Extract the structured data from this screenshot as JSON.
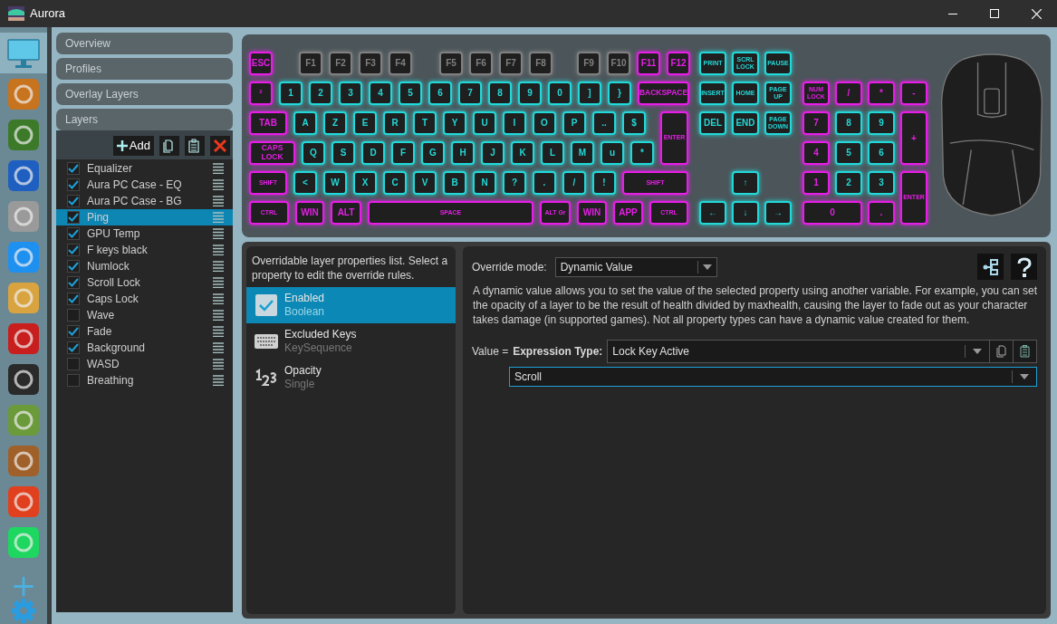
{
  "window": {
    "title": "Aurora"
  },
  "sidebar": {
    "apps": [
      {
        "kind": "monitor",
        "selected": true,
        "color": "#5fc8e8"
      },
      {
        "kind": "logo",
        "selected": false,
        "color": "#c8731e"
      },
      {
        "kind": "logo",
        "selected": false,
        "color": "#3c7a2a"
      },
      {
        "kind": "logo",
        "selected": false,
        "color": "#1e5fbf"
      },
      {
        "kind": "logo",
        "selected": false,
        "color": "#9a9a9a"
      },
      {
        "kind": "logo",
        "selected": false,
        "color": "#1e90f0"
      },
      {
        "kind": "logo",
        "selected": false,
        "color": "#d9a440"
      },
      {
        "kind": "logo",
        "selected": false,
        "color": "#c81e1e"
      },
      {
        "kind": "logo",
        "selected": false,
        "color": "#2a2a2a"
      },
      {
        "kind": "logo",
        "selected": false,
        "color": "#6a9a3a"
      },
      {
        "kind": "logo",
        "selected": false,
        "color": "#a0602a"
      },
      {
        "kind": "logo",
        "selected": false,
        "color": "#e0401e"
      },
      {
        "kind": "logo",
        "selected": false,
        "color": "#1ed760"
      }
    ]
  },
  "sections": [
    {
      "label": "Overview",
      "expanded": false
    },
    {
      "label": "Profiles",
      "expanded": false
    },
    {
      "label": "Overlay Layers",
      "expanded": false
    },
    {
      "label": "Layers",
      "expanded": true
    }
  ],
  "layer_toolbar": {
    "add_label": "Add"
  },
  "layers": [
    {
      "name": "Equalizer",
      "checked": true,
      "selected": false
    },
    {
      "name": "Aura PC Case - EQ",
      "checked": true,
      "selected": false
    },
    {
      "name": "Aura PC Case - BG",
      "checked": true,
      "selected": false
    },
    {
      "name": "Ping",
      "checked": true,
      "selected": true
    },
    {
      "name": "GPU Temp",
      "checked": true,
      "selected": false
    },
    {
      "name": "F keys black",
      "checked": true,
      "selected": false
    },
    {
      "name": "Numlock",
      "checked": true,
      "selected": false
    },
    {
      "name": "Scroll Lock",
      "checked": true,
      "selected": false
    },
    {
      "name": "Caps Lock",
      "checked": true,
      "selected": false
    },
    {
      "name": "Wave",
      "checked": false,
      "selected": false
    },
    {
      "name": "Fade",
      "checked": true,
      "selected": false
    },
    {
      "name": "Background",
      "checked": true,
      "selected": false
    },
    {
      "name": "WASD",
      "checked": false,
      "selected": false
    },
    {
      "name": "Breathing",
      "checked": false,
      "selected": false
    }
  ],
  "keyboard": {
    "main_rows": [
      [
        {
          "label": "ESC",
          "color": "#e61ee6"
        },
        {
          "label": "F1",
          "color": "#808080"
        },
        {
          "label": "F2",
          "color": "#808080"
        },
        {
          "label": "F3",
          "color": "#808080"
        },
        {
          "label": "F4",
          "color": "#808080"
        },
        {
          "label": "F5",
          "color": "#808080"
        },
        {
          "label": "F6",
          "color": "#808080"
        },
        {
          "label": "F7",
          "color": "#808080"
        },
        {
          "label": "F8",
          "color": "#808080"
        },
        {
          "label": "F9",
          "color": "#808080"
        },
        {
          "label": "F10",
          "color": "#808080"
        },
        {
          "label": "F11",
          "color": "#e61ee6"
        },
        {
          "label": "F12",
          "color": "#e61ee6"
        }
      ],
      [
        {
          "label": "²",
          "color": "#e61ee6"
        },
        {
          "label": "1",
          "color": "#22d8d8"
        },
        {
          "label": "2",
          "color": "#22d8d8"
        },
        {
          "label": "3",
          "color": "#22d8d8"
        },
        {
          "label": "4",
          "color": "#22d8d8"
        },
        {
          "label": "5",
          "color": "#22d8d8"
        },
        {
          "label": "6",
          "color": "#22d8d8"
        },
        {
          "label": "7",
          "color": "#22d8d8"
        },
        {
          "label": "8",
          "color": "#22d8d8"
        },
        {
          "label": "9",
          "color": "#22d8d8"
        },
        {
          "label": "0",
          "color": "#22d8d8"
        },
        {
          "label": "]",
          "color": "#22d8d8"
        },
        {
          "label": "}",
          "color": "#22d8d8"
        },
        {
          "label": "BACKSPACE",
          "color": "#e61ee6"
        }
      ],
      [
        {
          "label": "TAB",
          "color": "#e61ee6"
        },
        {
          "label": "A",
          "color": "#22d8d8"
        },
        {
          "label": "Z",
          "color": "#22d8d8"
        },
        {
          "label": "E",
          "color": "#22d8d8"
        },
        {
          "label": "R",
          "color": "#22d8d8"
        },
        {
          "label": "T",
          "color": "#22d8d8"
        },
        {
          "label": "Y",
          "color": "#22d8d8"
        },
        {
          "label": "U",
          "color": "#22d8d8"
        },
        {
          "label": "I",
          "color": "#22d8d8"
        },
        {
          "label": "O",
          "color": "#22d8d8"
        },
        {
          "label": "P",
          "color": "#22d8d8"
        },
        {
          "label": "..",
          "color": "#22d8d8"
        },
        {
          "label": "$",
          "color": "#22d8d8"
        },
        {
          "label": "ENTER",
          "color": "#e61ee6"
        }
      ],
      [
        {
          "label": "CAPS LOCK",
          "color": "#e61ee6"
        },
        {
          "label": "Q",
          "color": "#22d8d8"
        },
        {
          "label": "S",
          "color": "#22d8d8"
        },
        {
          "label": "D",
          "color": "#22d8d8"
        },
        {
          "label": "F",
          "color": "#22d8d8"
        },
        {
          "label": "G",
          "color": "#22d8d8"
        },
        {
          "label": "H",
          "color": "#22d8d8"
        },
        {
          "label": "J",
          "color": "#22d8d8"
        },
        {
          "label": "K",
          "color": "#22d8d8"
        },
        {
          "label": "L",
          "color": "#22d8d8"
        },
        {
          "label": "M",
          "color": "#22d8d8"
        },
        {
          "label": "u",
          "color": "#22d8d8"
        },
        {
          "label": "*",
          "color": "#22d8d8"
        }
      ],
      [
        {
          "label": "SHIFT",
          "color": "#e61ee6"
        },
        {
          "label": "<",
          "color": "#22d8d8"
        },
        {
          "label": "W",
          "color": "#22d8d8"
        },
        {
          "label": "X",
          "color": "#22d8d8"
        },
        {
          "label": "C",
          "color": "#22d8d8"
        },
        {
          "label": "V",
          "color": "#22d8d8"
        },
        {
          "label": "B",
          "color": "#22d8d8"
        },
        {
          "label": "N",
          "color": "#22d8d8"
        },
        {
          "label": "?",
          "color": "#22d8d8"
        },
        {
          "label": ".",
          "color": "#22d8d8"
        },
        {
          "label": "/",
          "color": "#22d8d8"
        },
        {
          "label": "!",
          "color": "#22d8d8"
        },
        {
          "label": "SHIFT",
          "color": "#e61ee6"
        }
      ],
      [
        {
          "label": "CTRL",
          "color": "#e61ee6"
        },
        {
          "label": "WIN",
          "color": "#e61ee6"
        },
        {
          "label": "ALT",
          "color": "#e61ee6"
        },
        {
          "label": "SPACE",
          "color": "#e61ee6"
        },
        {
          "label": "ALT Gr",
          "color": "#e61ee6"
        },
        {
          "label": "WIN",
          "color": "#e61ee6"
        },
        {
          "label": "APP",
          "color": "#e61ee6"
        },
        {
          "label": "CTRL",
          "color": "#e61ee6"
        }
      ]
    ],
    "nav_keys": [
      {
        "label": "PRINT",
        "color": "#22d8d8"
      },
      {
        "label": "SCRL LOCK",
        "color": "#22d8d8"
      },
      {
        "label": "PAUSE",
        "color": "#22d8d8"
      },
      {
        "label": "INSERT",
        "color": "#22d8d8"
      },
      {
        "label": "HOME",
        "color": "#22d8d8"
      },
      {
        "label": "PAGE UP",
        "color": "#22d8d8"
      },
      {
        "label": "DEL",
        "color": "#22d8d8"
      },
      {
        "label": "END",
        "color": "#22d8d8"
      },
      {
        "label": "PAGE DOWN",
        "color": "#22d8d8"
      },
      {
        "label": "↑",
        "color": "#22d8d8"
      },
      {
        "label": "←",
        "color": "#22d8d8"
      },
      {
        "label": "↓",
        "color": "#22d8d8"
      },
      {
        "label": "→",
        "color": "#22d8d8"
      }
    ],
    "numpad_keys": [
      {
        "label": "NUM LOCK",
        "color": "#e61ee6"
      },
      {
        "label": "/",
        "color": "#e61ee6"
      },
      {
        "label": "*",
        "color": "#e61ee6"
      },
      {
        "label": "-",
        "color": "#e61ee6"
      },
      {
        "label": "7",
        "color": "#e61ee6"
      },
      {
        "label": "8",
        "color": "#22d8d8"
      },
      {
        "label": "9",
        "color": "#22d8d8"
      },
      {
        "label": "+",
        "color": "#e61ee6"
      },
      {
        "label": "4",
        "color": "#e61ee6"
      },
      {
        "label": "5",
        "color": "#22d8d8"
      },
      {
        "label": "6",
        "color": "#22d8d8"
      },
      {
        "label": "1",
        "color": "#e61ee6"
      },
      {
        "label": "2",
        "color": "#22d8d8"
      },
      {
        "label": "3",
        "color": "#22d8d8"
      },
      {
        "label": "ENTER",
        "color": "#e61ee6"
      },
      {
        "label": "0",
        "color": "#e61ee6"
      },
      {
        "label": ".",
        "color": "#e61ee6"
      }
    ]
  },
  "properties": {
    "intro": "Overridable layer properties list. Select a property to edit the override rules.",
    "items": [
      {
        "kind": "checkbox",
        "name": "Enabled",
        "type": "Boolean",
        "selected": true
      },
      {
        "kind": "keyboard",
        "name": "Excluded Keys",
        "type": "KeySequence",
        "selected": false
      },
      {
        "kind": "number",
        "name": "Opacity",
        "type": "Single",
        "selected": false
      }
    ]
  },
  "override": {
    "mode_label": "Override mode:",
    "mode_value": "Dynamic Value",
    "description": "A dynamic value allows you to set the value of the selected property using another variable. For example, you can set the opacity of a layer to be the result of health divided by maxhealth, causing the layer to fade out as your character takes damage (in supported games). Not all property types can have a dynamic value created for them.",
    "value_label": "Value =",
    "expression_label": "Expression Type:",
    "expression_value": "Lock Key Active",
    "key_value": "Scroll"
  }
}
